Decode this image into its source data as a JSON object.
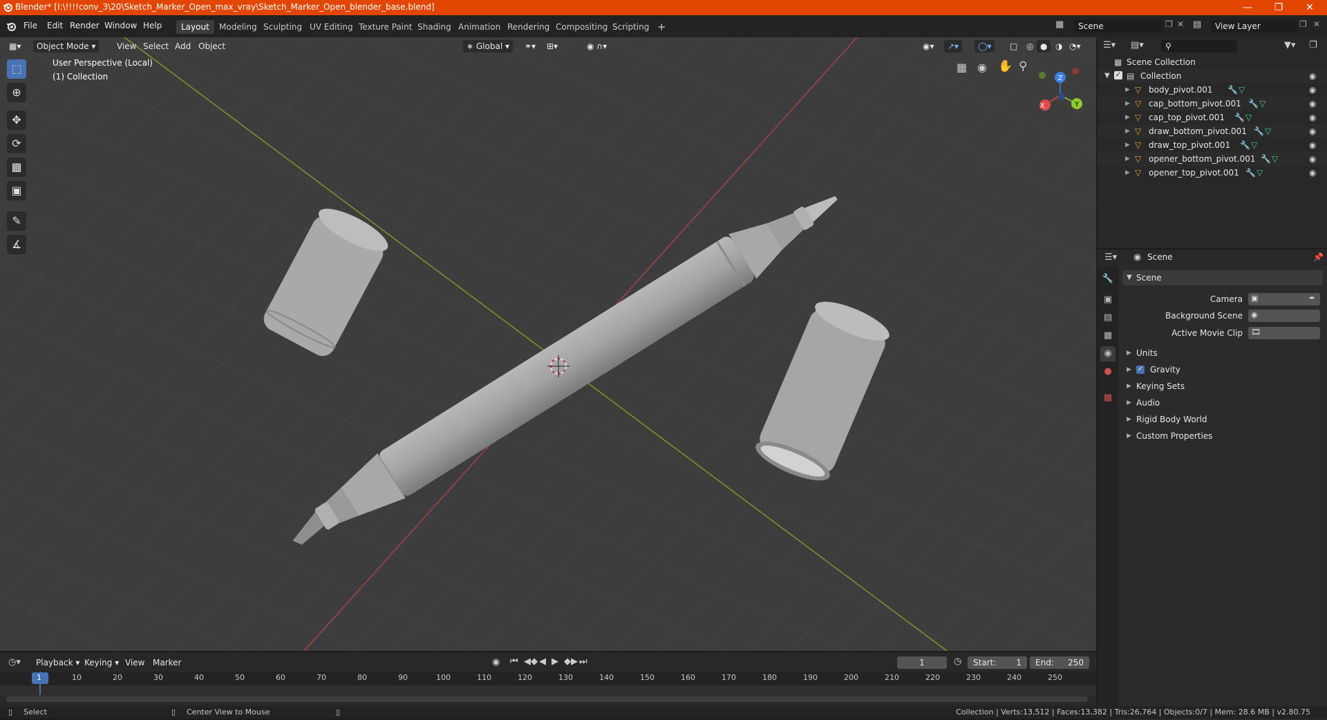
{
  "window": {
    "title": "Blender* [I:\\!!!!conv_3\\20\\Sketch_Marker_Open_max_vray\\Sketch_Marker_Open_blender_base.blend]",
    "accent": "#e24600"
  },
  "menu": [
    "File",
    "Edit",
    "Render",
    "Window",
    "Help"
  ],
  "workspaces": [
    "Layout",
    "Modeling",
    "Sculpting",
    "UV Editing",
    "Texture Paint",
    "Shading",
    "Animation",
    "Rendering",
    "Compositing",
    "Scripting"
  ],
  "active_workspace": "Layout",
  "scene_field": "Scene",
  "view_layer_field": "View Layer",
  "viewport_header": {
    "mode": "Object Mode",
    "menus": [
      "View",
      "Select",
      "Add",
      "Object"
    ],
    "transform_orientation": "Global"
  },
  "viewport": {
    "overlay_line1": "User Perspective (Local)",
    "overlay_line2": "(1) Collection",
    "gizmo_axes": [
      "X",
      "Y",
      "Z"
    ]
  },
  "outliner": {
    "root": "Scene Collection",
    "collection": "Collection",
    "items": [
      "body_pivot.001",
      "cap_bottom_pivot.001",
      "cap_top_pivot.001",
      "draw_bottom_pivot.001",
      "draw_top_pivot.001",
      "opener_bottom_pivot.001",
      "opener_top_pivot.001"
    ]
  },
  "properties": {
    "context": "Scene",
    "panel_title": "Scene",
    "fields": {
      "camera": "Camera",
      "background_scene": "Background Scene",
      "active_movie_clip": "Active Movie Clip"
    },
    "subpanels": [
      "Units",
      "Gravity",
      "Keying Sets",
      "Audio",
      "Rigid Body World",
      "Custom Properties"
    ],
    "gravity_checked": true
  },
  "timeline": {
    "menus": [
      "Playback",
      "Keying",
      "View",
      "Marker"
    ],
    "current_frame": "1",
    "start_label": "Start:",
    "start": "1",
    "end_label": "End:",
    "end": "250",
    "ticks": [
      "1",
      "10",
      "20",
      "30",
      "40",
      "50",
      "60",
      "70",
      "80",
      "90",
      "100",
      "110",
      "120",
      "130",
      "140",
      "150",
      "160",
      "170",
      "180",
      "190",
      "200",
      "210",
      "220",
      "230",
      "240",
      "250"
    ]
  },
  "statusbar": {
    "left": "Select",
    "middle": "Center View to Mouse",
    "right": "Collection | Verts:13,512 | Faces:13,382 | Tris:26,764 | Objects:0/7 | Mem: 28.6 MB | v2.80.75"
  }
}
